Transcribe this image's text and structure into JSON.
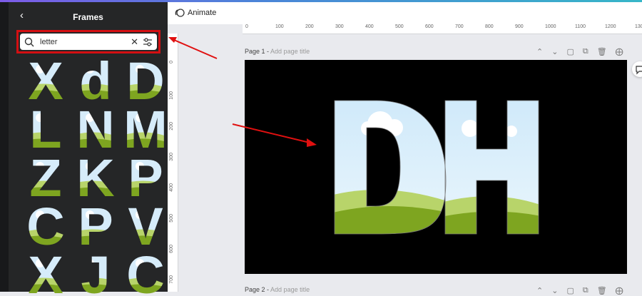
{
  "panel": {
    "title": "Frames",
    "search_value": "letter",
    "letters": [
      "X",
      "d",
      "D",
      "L",
      "N",
      "M",
      "Z",
      "K",
      "P",
      "C",
      "P",
      "V",
      "X",
      "J",
      "C"
    ]
  },
  "toolbar": {
    "animate_label": "Animate"
  },
  "ruler": {
    "h": [
      "0",
      "100",
      "200",
      "300",
      "400",
      "500",
      "600",
      "700",
      "800",
      "900",
      "1000",
      "1100",
      "1200",
      "130"
    ],
    "v": [
      "0",
      "100",
      "200",
      "300",
      "400",
      "500",
      "600",
      "700"
    ]
  },
  "page1": {
    "label": "Page 1 -",
    "subtitle": "Add page title",
    "letters": "DH"
  },
  "page2": {
    "label": "Page 2 -",
    "subtitle": "Add page title"
  },
  "colors": {
    "accent_red": "#d40f12",
    "sky": "#cde8f7",
    "grass": "#7ea520",
    "canvas": "#000000"
  }
}
